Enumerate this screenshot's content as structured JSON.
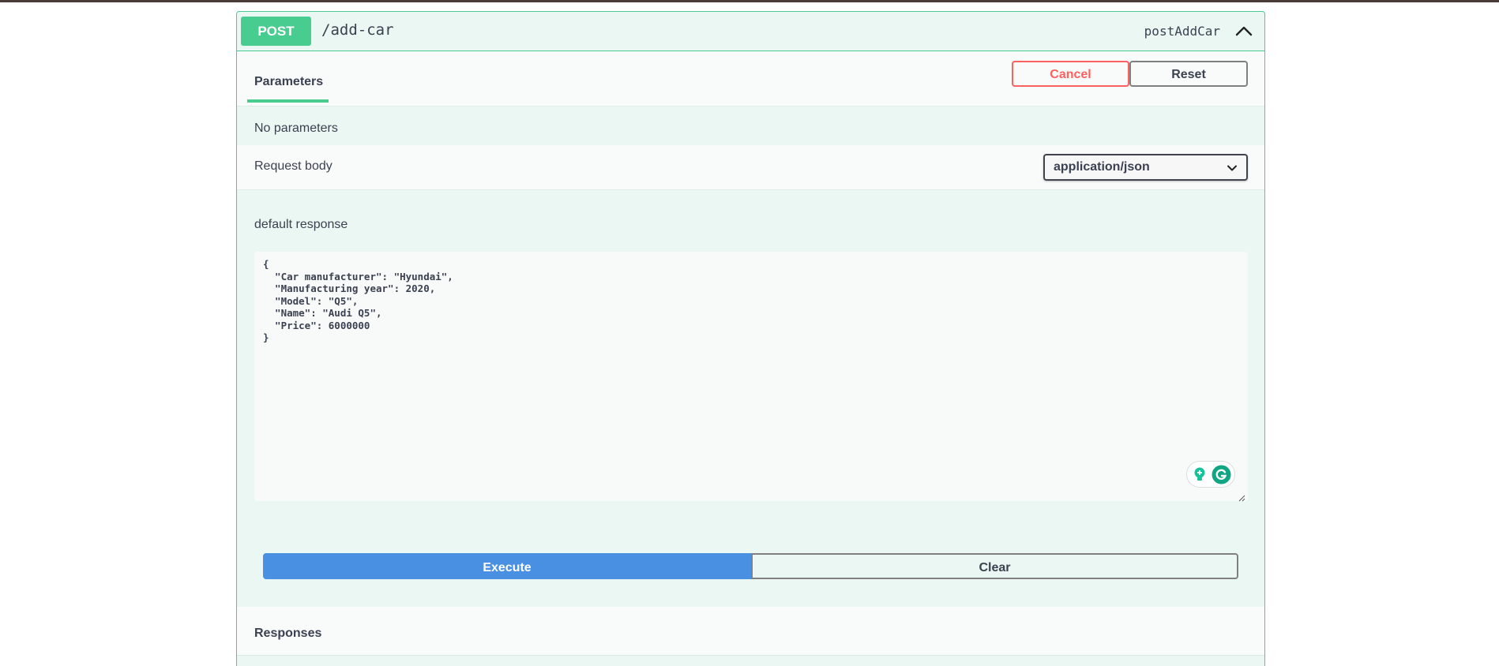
{
  "operation": {
    "method": "POST",
    "path": "/add-car",
    "operation_id": "postAddCar"
  },
  "tabs": {
    "parameters_label": "Parameters"
  },
  "actions": {
    "cancel_label": "Cancel",
    "reset_label": "Reset",
    "execute_label": "Execute",
    "clear_label": "Clear"
  },
  "parameters": {
    "empty_text": "No parameters"
  },
  "request_body": {
    "label": "Request body",
    "content_type": "application/json",
    "example_label": "default response",
    "value": "{\n  \"Car manufacturer\": \"Hyundai\",\n  \"Manufacturing year\": 2020,\n  \"Model\": \"Q5\",\n  \"Name\": \"Audi Q5\",\n  \"Price\": 6000000\n}"
  },
  "responses": {
    "label": "Responses"
  },
  "icons": {
    "collapse": "chevron-up-icon",
    "dropdown": "chevron-down-icon",
    "grammarly_suggest": "lightbulb-icon",
    "grammarly": "grammarly-icon",
    "resize": "resize-handle-icon"
  },
  "colors": {
    "post_accent": "#49cc90",
    "cancel": "#ff6060",
    "execute": "#4990e2",
    "text": "#3b4151",
    "block_background": "#ebf7f2"
  }
}
